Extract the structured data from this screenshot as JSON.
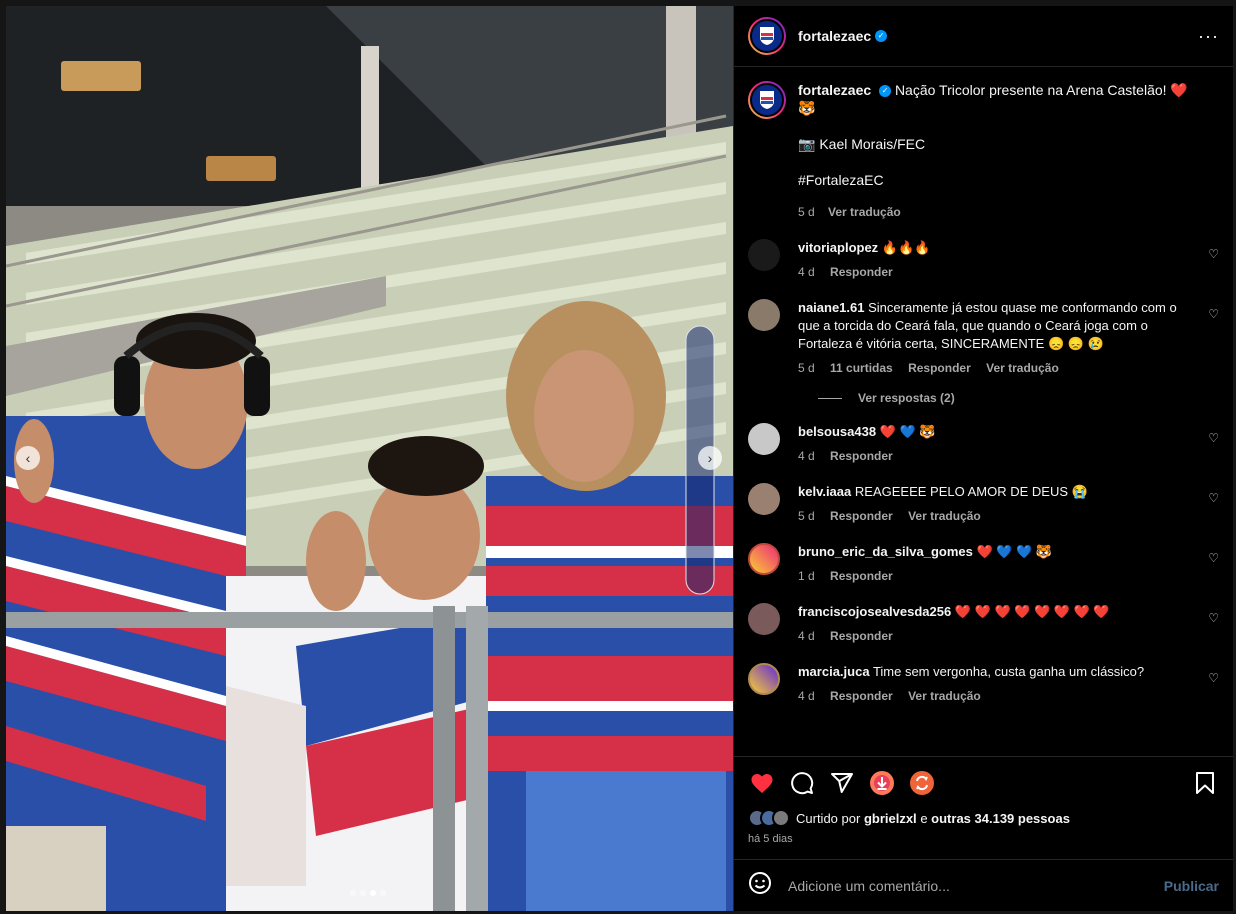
{
  "post": {
    "username": "fortalezaec",
    "verified_icon": "verified-badge-icon",
    "more_icon": "more-options-icon",
    "caption_text": "Nação Tricolor presente na Arena Castelão! ❤️ 🐯",
    "caption_credit": "📷 Kael Morais/FEC",
    "caption_hashtag": "#FortalezaEC",
    "caption_time": "5 d",
    "caption_translate": "Ver tradução"
  },
  "carousel": {
    "prev_icon": "chevron-left-icon",
    "next_icon": "chevron-right-icon",
    "slide_count": 4,
    "active_slide": 3
  },
  "comments": [
    {
      "username": "vitoriaplopez",
      "text": "🔥🔥🔥",
      "time": "4 d",
      "likes": "",
      "reply": "Responder",
      "translate": "",
      "avatar_color": "#1a1a1a"
    },
    {
      "username": "naiane1.61",
      "text": "Sinceramente já estou quase me conformando com o que a torcida do Ceará fala, que quando o Ceará joga com o Fortaleza é vitória certa, SINCERAMENTE 😞 😞 😢",
      "time": "5 d",
      "likes": "11 curtidas",
      "reply": "Responder",
      "translate": "Ver tradução",
      "avatar_color": "#8a7a6a"
    },
    {
      "username": "belsousa438",
      "text": "❤️ 💙 🐯",
      "time": "4 d",
      "likes": "",
      "reply": "Responder",
      "translate": "",
      "avatar_color": "#c8c8c8"
    },
    {
      "username": "kelv.iaaa",
      "text": "REAGEEEE PELO AMOR DE DEUS 😭",
      "time": "5 d",
      "likes": "",
      "reply": "Responder",
      "translate": "Ver tradução",
      "avatar_color": "#9a8070"
    },
    {
      "username": "bruno_eric_da_silva_gomes",
      "text": "❤️ 💙 💙 🐯",
      "time": "1 d",
      "likes": "",
      "reply": "Responder",
      "translate": "",
      "avatar_color": "#c04a3a"
    },
    {
      "username": "franciscojosealvesda256",
      "text": "❤️ ❤️ ❤️ ❤️ ❤️ ❤️ ❤️ ❤️",
      "time": "4 d",
      "likes": "",
      "reply": "Responder",
      "translate": "",
      "avatar_color": "#7a5a5a"
    },
    {
      "username": "marcia.juca",
      "text": "Time sem vergonha, custa ganha um clássico?",
      "time": "4 d",
      "likes": "",
      "reply": "Responder",
      "translate": "Ver tradução",
      "avatar_color": "#b08a50"
    }
  ],
  "view_replies": "Ver respostas (2)",
  "actions": {
    "like_icon": "heart-filled-icon",
    "comment_icon": "comment-icon",
    "share_icon": "share-icon",
    "download_icon": "download-icon",
    "repost_icon": "repost-icon",
    "save_icon": "bookmark-icon",
    "liked_prefix": "Curtido por",
    "liked_user": "gbrielzxl",
    "liked_and": "e",
    "liked_others": "outras 34.139 pessoas",
    "posted_ago": "há 5 dias"
  },
  "composer": {
    "emoji_icon": "emoji-icon",
    "placeholder": "Adicione um comentário...",
    "publish_label": "Publicar"
  },
  "colors": {
    "accent": "#0095f6",
    "like": "#ff3040",
    "background": "#000000"
  }
}
